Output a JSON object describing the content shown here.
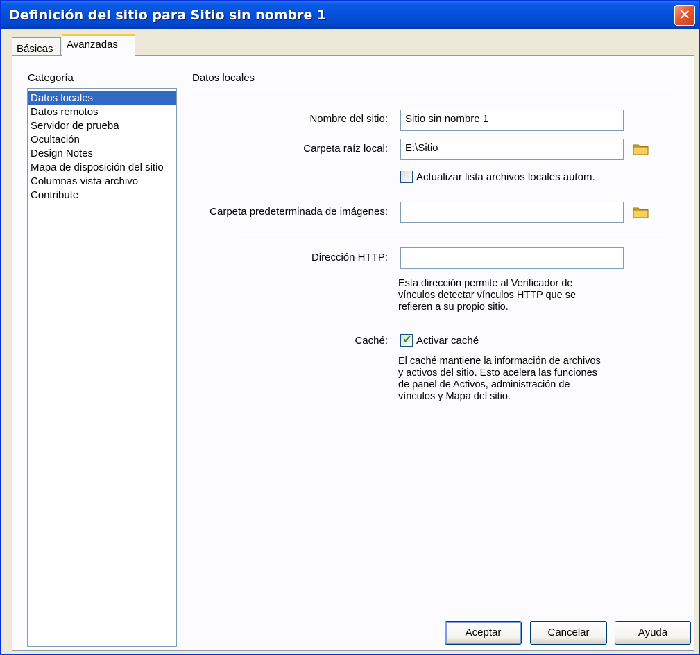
{
  "window": {
    "title": "Definición del sitio para Sitio sin nombre 1",
    "close_glyph": "✕"
  },
  "tabs": [
    {
      "label": "Básicas",
      "selected": false
    },
    {
      "label": "Avanzadas",
      "selected": true
    }
  ],
  "sidebar": {
    "heading": "Categoría",
    "items": [
      {
        "label": "Datos locales",
        "selected": true
      },
      {
        "label": "Datos remotos"
      },
      {
        "label": "Servidor de prueba"
      },
      {
        "label": "Ocultación"
      },
      {
        "label": "Design Notes"
      },
      {
        "label": "Mapa de disposición del sitio"
      },
      {
        "label": "Columnas vista archivo"
      },
      {
        "label": "Contribute"
      }
    ]
  },
  "main": {
    "section_title": "Datos locales",
    "site_name": {
      "label": "Nombre del sitio:",
      "value": "Sitio sin nombre 1"
    },
    "local_root": {
      "label": "Carpeta raíz local:",
      "value": "E:\\Sitio"
    },
    "auto_refresh": {
      "label": "Actualizar lista archivos locales autom.",
      "checked": false
    },
    "default_images": {
      "label": "Carpeta predeterminada de imágenes:",
      "value": ""
    },
    "http_address": {
      "label": "Dirección HTTP:",
      "value": "",
      "description_lines": [
        "Esta dirección permite al Verificador de",
        "vínculos detectar vínculos HTTP que se",
        "refieren a su propio sitio."
      ]
    },
    "cache": {
      "label": "Caché:",
      "checkbox_label": "Activar caché",
      "checked": true,
      "description_lines": [
        "El caché mantiene la información de archivos",
        "y activos del sitio. Esto acelera las funciones",
        "de panel de Activos, administración de",
        "vínculos y Mapa del sitio."
      ]
    }
  },
  "buttons": {
    "accept": "Aceptar",
    "cancel": "Cancelar",
    "help": "Ayuda"
  },
  "icons": {
    "folder": "folder-icon",
    "close": "close-icon",
    "check": "checkmark-icon"
  },
  "colors": {
    "titlebar": "#0450d8",
    "selection": "#316ac5",
    "dialog_bg": "#ece9d8",
    "panel_bg": "#fcfcfe",
    "tab_accent": "#ffc83c",
    "folder": "#f5c542"
  }
}
